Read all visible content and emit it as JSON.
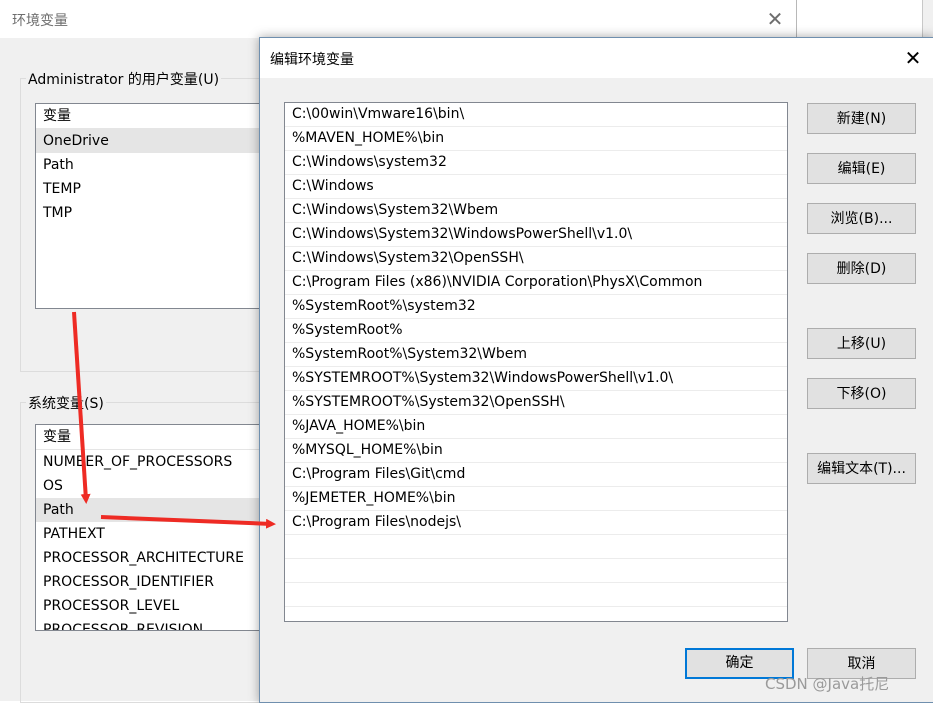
{
  "back_window": {
    "title": "环境变量",
    "close_glyph": "✕",
    "user_group_label": "Administrator 的用户变量(U)",
    "user_list": {
      "header": "变量",
      "rows": [
        "OneDrive",
        "Path",
        "TEMP",
        "TMP"
      ],
      "selected_index": 0
    },
    "system_group_label": "系统变量(S)",
    "system_list": {
      "header": "变量",
      "rows": [
        "NUMBER_OF_PROCESSORS",
        "OS",
        "Path",
        "PATHEXT",
        "PROCESSOR_ARCHITECTURE",
        "PROCESSOR_IDENTIFIER",
        "PROCESSOR_LEVEL",
        "PROCESSOR_REVISION"
      ],
      "selected_index": 2
    }
  },
  "dialog": {
    "title": "编辑环境变量",
    "close_glyph": "✕",
    "paths": [
      "C:\\00win\\Vmware16\\bin\\",
      "%MAVEN_HOME%\\bin",
      "C:\\Windows\\system32",
      "C:\\Windows",
      "C:\\Windows\\System32\\Wbem",
      "C:\\Windows\\System32\\WindowsPowerShell\\v1.0\\",
      "C:\\Windows\\System32\\OpenSSH\\",
      "C:\\Program Files (x86)\\NVIDIA Corporation\\PhysX\\Common",
      "%SystemRoot%\\system32",
      "%SystemRoot%",
      "%SystemRoot%\\System32\\Wbem",
      "%SYSTEMROOT%\\System32\\WindowsPowerShell\\v1.0\\",
      "%SYSTEMROOT%\\System32\\OpenSSH\\",
      "%JAVA_HOME%\\bin",
      "%MYSQL_HOME%\\bin",
      "C:\\Program Files\\Git\\cmd",
      "%JEMETER_HOME%\\bin",
      "C:\\Program Files\\nodejs\\"
    ],
    "buttons": {
      "new": "新建(N)",
      "edit": "编辑(E)",
      "browse": "浏览(B)...",
      "delete": "删除(D)",
      "move_up": "上移(U)",
      "move_down": "下移(O)",
      "edit_text": "编辑文本(T)...",
      "ok": "确定",
      "cancel": "取消"
    }
  },
  "watermark": "CSDN @Java托尼",
  "colors": {
    "arrow": "#ee2b24",
    "accent": "#0078d7"
  }
}
